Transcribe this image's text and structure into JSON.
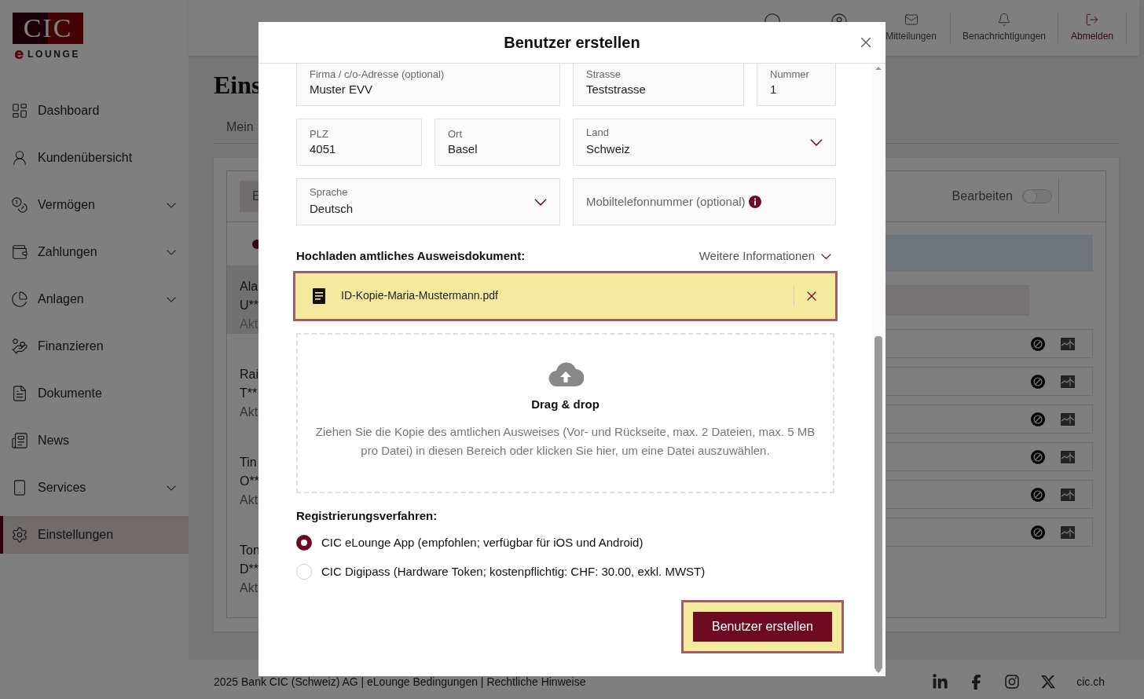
{
  "sidebar": {
    "logo": {
      "mark": "CIC",
      "sub": "LOUNGE"
    },
    "items": [
      {
        "label": "Dashboard",
        "expandable": false,
        "selected": false
      },
      {
        "label": "Kundenübersicht",
        "expandable": false,
        "selected": false
      },
      {
        "label": "Vermögen",
        "expandable": true,
        "selected": false
      },
      {
        "label": "Zahlungen",
        "expandable": true,
        "selected": false
      },
      {
        "label": "Anlagen",
        "expandable": true,
        "selected": false
      },
      {
        "label": "Finanzieren",
        "expandable": false,
        "selected": false
      },
      {
        "label": "Dokumente",
        "expandable": false,
        "selected": false
      },
      {
        "label": "News",
        "expandable": false,
        "selected": false
      },
      {
        "label": "Services",
        "expandable": true,
        "selected": false
      },
      {
        "label": "Einstellungen",
        "expandable": false,
        "selected": true
      }
    ]
  },
  "top_bar": {
    "items": [
      {
        "label": "Mitteilungen",
        "kind": "mail"
      },
      {
        "label": "Benachrichtigungen",
        "kind": "bell"
      },
      {
        "label": "Abmelden",
        "kind": "logout"
      }
    ]
  },
  "page": {
    "title": "Eins",
    "tab": "Mein",
    "panel_button": "E",
    "edit_toggle": {
      "label": "Bearbeiten",
      "on": false
    },
    "users": [
      {
        "name": "Ala",
        "code": "U**",
        "status": "Akt",
        "selected": true
      },
      {
        "name": "Rai",
        "code": "T**",
        "status": "Akt",
        "selected": false
      },
      {
        "name": "Tin",
        "code": "O**",
        "status": "Akt",
        "selected": false
      },
      {
        "name": "Ton",
        "code": "D**",
        "status": "Akt",
        "selected": false
      }
    ],
    "permission_rows": [
      {
        "kind": "row"
      },
      {
        "kind": "row"
      },
      {
        "kind": "row"
      },
      {
        "kind": "row"
      },
      {
        "kind": "row"
      },
      {
        "kind": "row"
      }
    ]
  },
  "footer": {
    "text": "2025 Bank CIC (Schweiz) AG | eLounge Bedingungen | Rechtliche Hinweise",
    "link": "cic.ch"
  },
  "dialog": {
    "title": "Benutzer erstellen",
    "form_rows": [
      [
        {
          "kind": "text",
          "label": "Firma / c/o-Adresse (optional)",
          "value": "Muster EVV"
        },
        {
          "kind": "text",
          "label": "Strasse",
          "value": "Teststrasse"
        },
        {
          "kind": "text",
          "label": "Nummer",
          "value": "1"
        }
      ],
      [
        {
          "kind": "text",
          "label": "PLZ",
          "value": "4051"
        },
        {
          "kind": "text",
          "label": "Ort",
          "value": "Basel"
        },
        {
          "kind": "select",
          "label": "Land",
          "value": "Schweiz"
        }
      ],
      [
        {
          "kind": "select",
          "label": "Sprache",
          "value": "Deutsch"
        },
        {
          "kind": "phone",
          "placeholder": "Mobiltelefonnummer (optional)"
        }
      ]
    ],
    "upload": {
      "heading": "Hochladen amtliches Ausweisdokument:",
      "more_info": "Weitere Informationen",
      "file": "ID-Kopie-Maria-Mustermann.pdf",
      "drop_title": "Drag & drop",
      "drop_text": "Ziehen Sie die Kopie des amtlichen Ausweises (Vor- und Rückseite, max. 2 Dateien, max. 5 MB pro Datei) in diesen Bereich oder klicken Sie hier, um eine Datei auszuwählen."
    },
    "registration": {
      "heading": "Registrierungsverfahren:",
      "options": [
        {
          "label": "CIC eLounge App (empfohlen; verfügbar für iOS und Android)",
          "selected": true
        },
        {
          "label": "CIC Digipass (Hardware Token; kostenpflichtig: CHF: 30.00, exkl. MWST)",
          "selected": false
        }
      ]
    },
    "submit": "Benutzer erstellen"
  }
}
